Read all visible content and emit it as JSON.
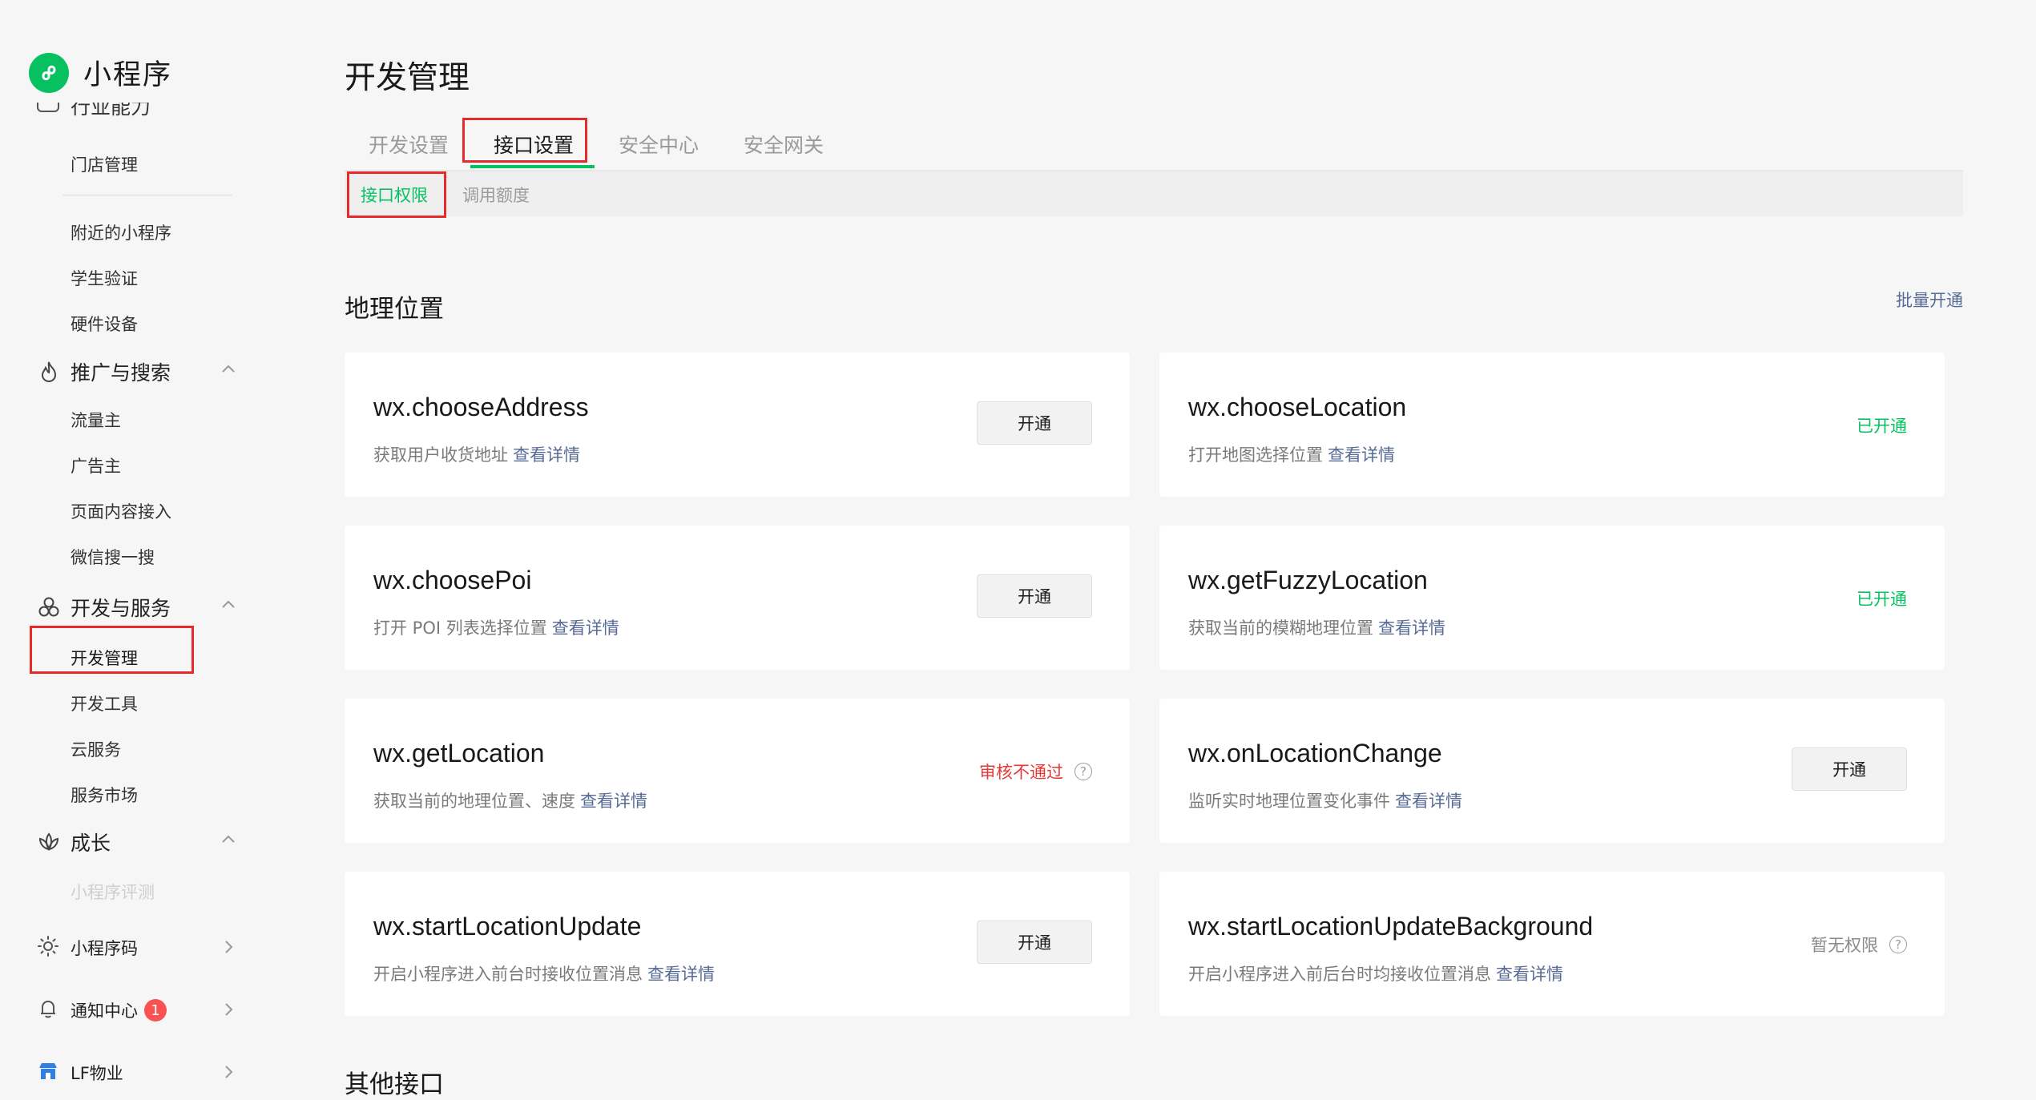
{
  "app": {
    "name": "小程序"
  },
  "sidebar": {
    "cut_item": "行业能力",
    "store_mgmt": "门店管理",
    "nearby": "附近的小程序",
    "student": "学生验证",
    "hardware": "硬件设备",
    "promo": {
      "label": "推广与搜索",
      "items": [
        "流量主",
        "广告主",
        "页面内容接入",
        "微信搜一搜"
      ]
    },
    "dev": {
      "label": "开发与服务",
      "items": [
        "开发管理",
        "开发工具",
        "云服务",
        "服务市场"
      ]
    },
    "growth": {
      "label": "成长",
      "items": [
        "小程序评测"
      ]
    },
    "bottom": [
      {
        "label": "小程序码"
      },
      {
        "label": "通知中心",
        "badge": "1"
      },
      {
        "label": "LF物业"
      }
    ]
  },
  "main": {
    "title": "开发管理",
    "tabs": [
      "开发设置",
      "接口设置",
      "安全中心",
      "安全网关"
    ],
    "active_tab": "接口设置",
    "subtabs": [
      "接口权限",
      "调用额度"
    ],
    "section_geo": "地理位置",
    "batch_link": "批量开通",
    "section_other": "其他接口",
    "link_text": "查看详情",
    "cards": [
      {
        "api": "wx.chooseAddress",
        "desc": "获取用户收货地址",
        "action": "开通"
      },
      {
        "api": "wx.chooseLocation",
        "desc": "打开地图选择位置",
        "status": "已开通"
      },
      {
        "api": "wx.choosePoi",
        "desc": "打开 POI 列表选择位置",
        "action": "开通"
      },
      {
        "api": "wx.getFuzzyLocation",
        "desc": "获取当前的模糊地理位置",
        "status": "已开通"
      },
      {
        "api": "wx.getLocation",
        "desc": "获取当前的地理位置、速度",
        "status": "审核不通过"
      },
      {
        "api": "wx.onLocationChange",
        "desc": "监听实时地理位置变化事件",
        "action": "开通"
      },
      {
        "api": "wx.startLocationUpdate",
        "desc": "开启小程序进入前台时接收位置消息",
        "action": "开通"
      },
      {
        "api": "wx.startLocationUpdateBackground",
        "desc": "开启小程序进入前后台时均接收位置消息",
        "status": "暂无权限"
      }
    ]
  },
  "colors": {
    "accent": "#07c160",
    "link": "#576b95",
    "error": "#e53935",
    "highlight_box": "#e52b2b"
  }
}
